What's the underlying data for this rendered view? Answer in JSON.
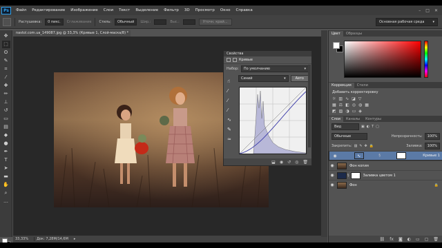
{
  "app": {
    "logo": "Ps",
    "menu": [
      "Файл",
      "Редактирование",
      "Изображение",
      "Слои",
      "Текст",
      "Выделение",
      "Фильтр",
      "3D",
      "Просмотр",
      "Окно",
      "Справка"
    ],
    "window_controls": [
      "–",
      "□",
      "✕"
    ]
  },
  "options": {
    "feather_label": "Растушевка:",
    "feather_value": "0 пикс.",
    "antialias_label": "Сглаживание",
    "style_label": "Стиль:",
    "style_value": "Обычный",
    "width_label": "Шир.:",
    "height_label": "Выс.:",
    "refine_button": "Уточн. край...",
    "workspace": "Основная рабочая среда"
  },
  "document": {
    "tab_title": "nastol.com.ua_149087.jpg @ 33,3% (Кривые 1, Слой-маска/8) *",
    "zoom": "33,33%",
    "doc_size": "Док: 7,28M/14,6M"
  },
  "properties": {
    "panel_title": "Свойства",
    "adjustment_name": "Кривые",
    "preset_label": "Набор:",
    "preset_value": "По умолчанию",
    "channel_value": "Синий",
    "auto_button": "Авто"
  },
  "color_panel": {
    "tabs": [
      "Цвет",
      "Образцы"
    ],
    "accent": "#ff0000"
  },
  "corrections_panel": {
    "tabs": [
      "Коррекция",
      "Стили"
    ],
    "title": "Добавить корректировку"
  },
  "layers_panel": {
    "tabs": [
      "Слои",
      "Каналы",
      "Контуры"
    ],
    "kind_value": "Вид",
    "blend_value": "Обычные",
    "opacity_label": "Непрозрачность:",
    "opacity_value": "100%",
    "lock_label": "Закрепить:",
    "fill_label": "Заливка:",
    "fill_value": "100%",
    "layers": [
      {
        "name": "Кривые 1"
      },
      {
        "name": "Фон копия"
      },
      {
        "name": "Заливка цветом 1"
      },
      {
        "name": "Фон"
      }
    ]
  }
}
